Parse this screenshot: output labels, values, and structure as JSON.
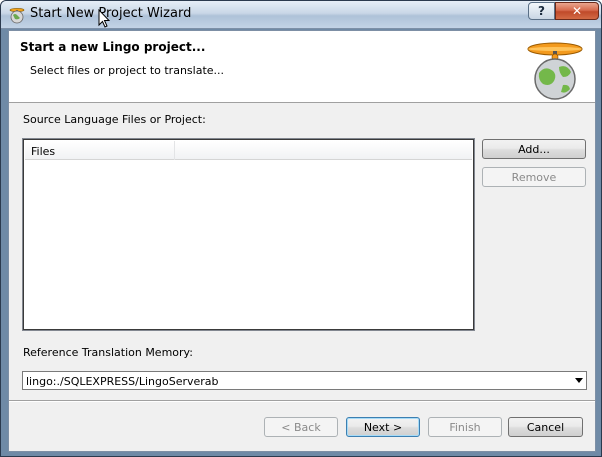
{
  "window": {
    "title": "Start New Project Wizard"
  },
  "titlebar_buttons": {
    "help": "?",
    "close": "✕"
  },
  "header": {
    "title": "Start a new Lingo project...",
    "subtitle": "Select files or project to translate..."
  },
  "source": {
    "label": "Source Language Files or Project:",
    "columns": [
      "Files"
    ],
    "add_label": "Add...",
    "remove_label": "Remove"
  },
  "tm": {
    "label": "Reference Translation Memory:",
    "selected": "lingo:./SQLEXPRESS/LingoServerab"
  },
  "footer": {
    "back_label": "< Back",
    "next_label": "Next >",
    "finish_label": "Finish",
    "cancel_label": "Cancel"
  },
  "icons": {
    "app": "lingo-app-icon",
    "logo": "lingo-globe-propeller-logo",
    "cursor": "mouse-cursor-icon"
  }
}
